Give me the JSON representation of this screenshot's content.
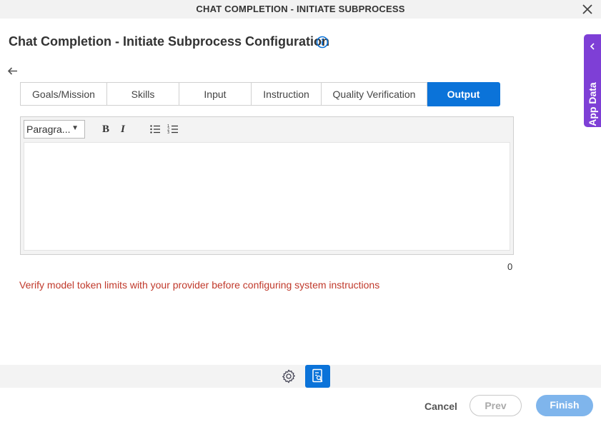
{
  "window": {
    "title": "CHAT COMPLETION - INITIATE SUBPROCESS",
    "close_icon": "close-icon"
  },
  "page": {
    "title": "Chat Completion - Initiate Subprocess Configuration",
    "info_icon": "info-icon",
    "back_icon": "arrow-left-icon"
  },
  "app_data": {
    "label": "App Data",
    "icon": "chevron-left-icon"
  },
  "tabs": [
    {
      "label": "Goals/Mission",
      "active": false
    },
    {
      "label": "Skills",
      "active": false
    },
    {
      "label": "Input",
      "active": false
    },
    {
      "label": "Instruction",
      "active": false
    },
    {
      "label": "Quality Verification",
      "active": false
    },
    {
      "label": "Output",
      "active": true
    }
  ],
  "editor": {
    "format_value": "Paragra...",
    "bold_label": "B",
    "italic_label": "I",
    "content": "",
    "char_count": "0"
  },
  "warning": "Verify model token limits with your provider before configuring system instructions",
  "footer": {
    "settings_icon": "gear-icon",
    "document_icon": "document-view-icon",
    "cancel_label": "Cancel",
    "prev_label": "Prev",
    "finish_label": "Finish"
  },
  "colors": {
    "accent": "#0b73d9",
    "app_data_tab": "#7e3fd6",
    "warning_text": "#c0392b",
    "finish_disabled": "#7fb5ec"
  }
}
